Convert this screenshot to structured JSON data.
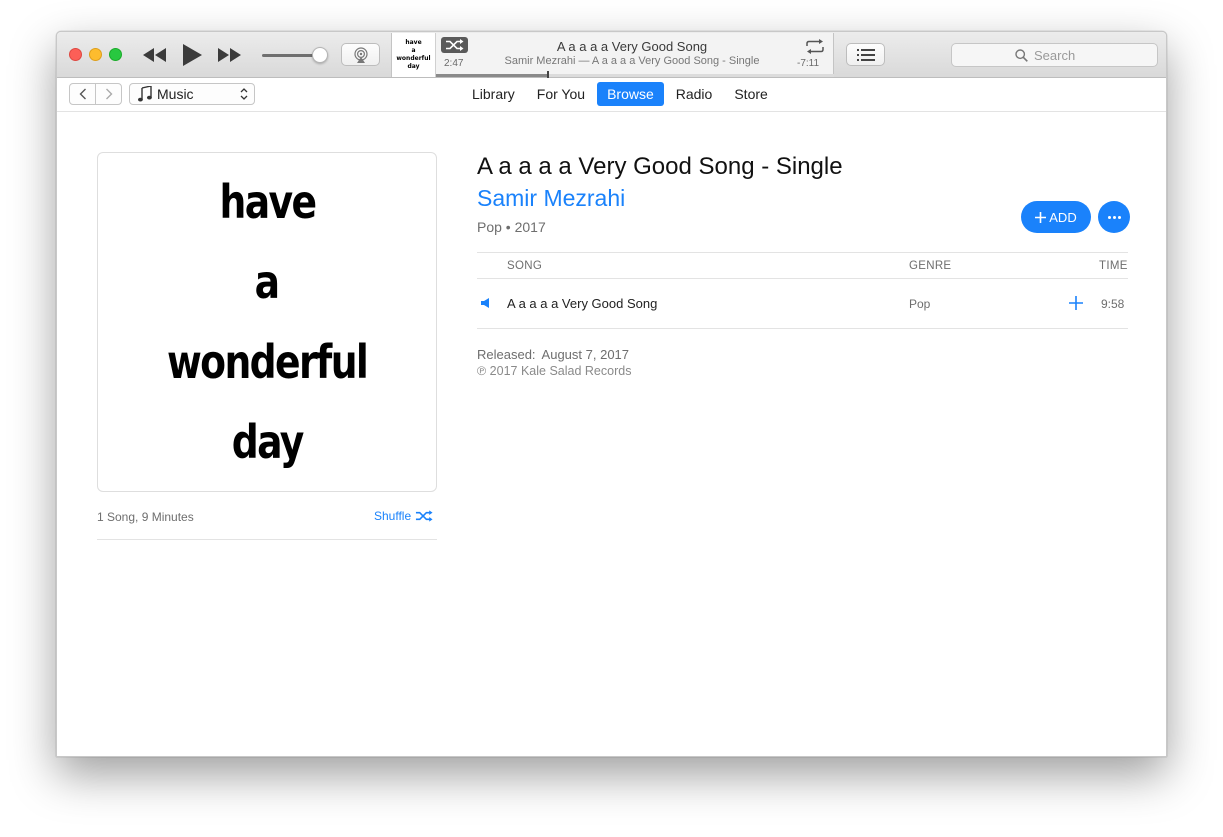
{
  "player": {
    "lcd_art_lines": [
      "have",
      "a",
      "wonderful",
      "day"
    ],
    "elapsed": "2:47",
    "remaining": "-7:11",
    "now_playing_title": "A a a a a Very Good Song",
    "now_playing_subtitle": "Samir Mezrahi — A a a a a Very Good Song - Single",
    "progress_fraction": 0.28
  },
  "search": {
    "placeholder": "Search"
  },
  "nav": {
    "media_kind": "Music",
    "tabs": [
      {
        "label": "Library",
        "active": false
      },
      {
        "label": "For You",
        "active": false
      },
      {
        "label": "Browse",
        "active": true
      },
      {
        "label": "Radio",
        "active": false
      },
      {
        "label": "Store",
        "active": false
      }
    ]
  },
  "album": {
    "artwork_lines": [
      "have",
      "a",
      "wonderful",
      "day"
    ],
    "title": "A a a a a Very Good Song - Single",
    "artist": "Samir Mezrahi",
    "genre_year": "Pop • 2017",
    "add_label": "ADD",
    "song_count": "1 Song, 9 Minutes",
    "shuffle_label": "Shuffle"
  },
  "table": {
    "headers": {
      "song": "SONG",
      "genre": "GENRE",
      "time": "TIME"
    },
    "tracks": [
      {
        "title": "A a a a a Very Good Song",
        "genre": "Pop",
        "time": "9:58"
      }
    ]
  },
  "footer": {
    "released_label": "Released:",
    "released_date": "August 7, 2017",
    "copyright": "℗ 2017 Kale Salad Records"
  },
  "colors": {
    "accent": "#1a82fb",
    "close": "#fc5f57",
    "minimize": "#fdbc2e",
    "maximize": "#28c840"
  }
}
